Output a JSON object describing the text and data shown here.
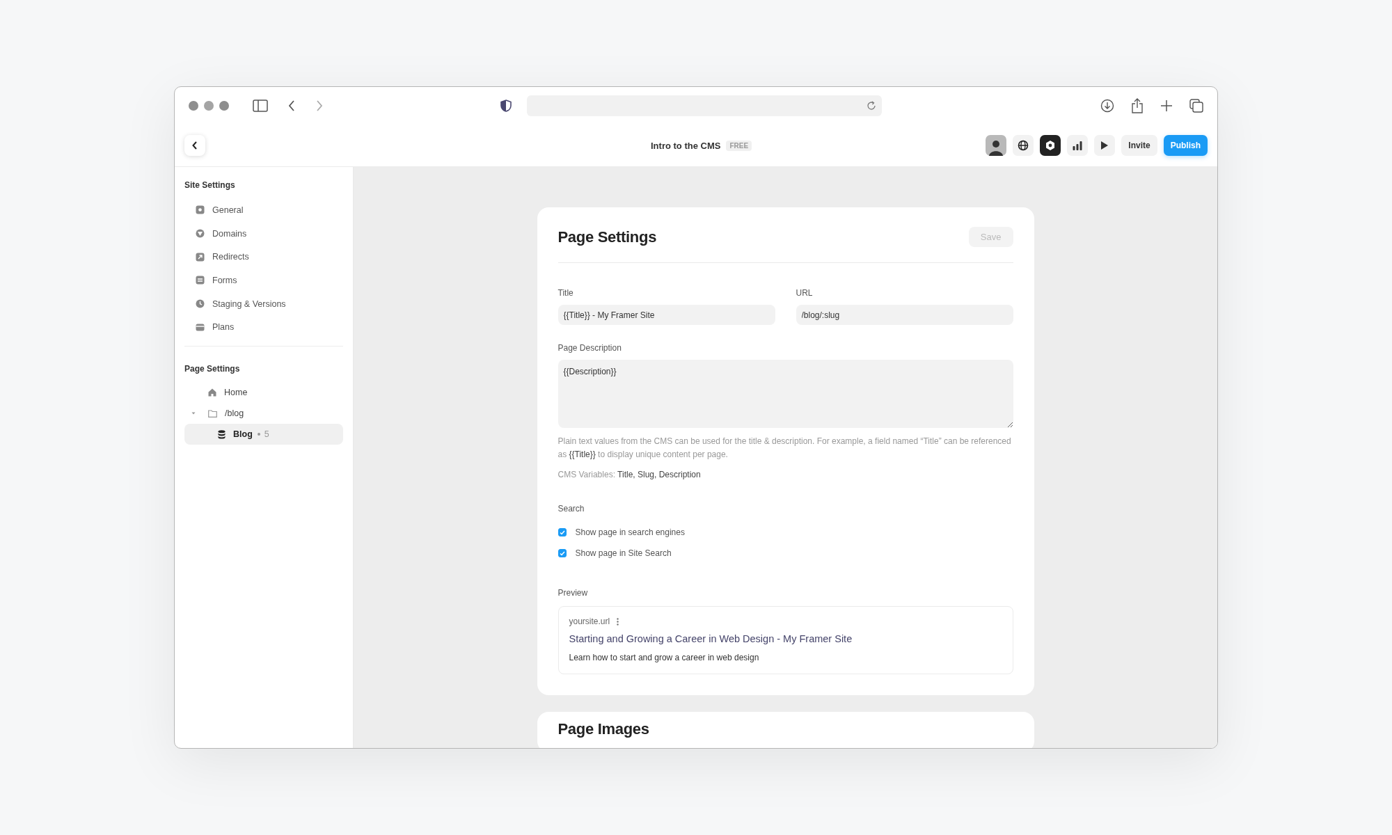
{
  "app_header": {
    "title": "Intro to the CMS",
    "badge": "FREE",
    "buttons": [
      {
        "label": "Invite",
        "kind": "secondary"
      },
      {
        "label": "Publish",
        "kind": "primary"
      }
    ]
  },
  "sidebar": {
    "site_settings": {
      "title": "Site Settings",
      "items": [
        {
          "label": "General",
          "kind": "general"
        },
        {
          "label": "Domains",
          "kind": "domains"
        },
        {
          "label": "Redirects",
          "kind": "redirects"
        },
        {
          "label": "Forms",
          "kind": "forms"
        },
        {
          "label": "Staging & Versions",
          "kind": "staging"
        },
        {
          "label": "Plans",
          "kind": "plans"
        }
      ]
    },
    "page_settings": {
      "title": "Page Settings",
      "tree": [
        {
          "label": "Home",
          "kind": "home",
          "selected": false
        },
        {
          "label": "/blog",
          "kind": "folder",
          "selected": false,
          "expanded": true,
          "children": [
            {
              "label": "Blog",
              "kind": "collection",
              "count": "5",
              "selected": true
            }
          ]
        }
      ]
    }
  },
  "card": {
    "title": "Page Settings",
    "save_button": {
      "label": "Save",
      "disabled": true
    },
    "fields": [
      {
        "label": "Title",
        "value": "{{Title}} - My Framer Site"
      },
      {
        "label": "URL",
        "value": "/blog/:slug"
      }
    ],
    "description": {
      "label": "Page Description",
      "value": "{{Description}}"
    },
    "help": "Plain text values from the CMS can be used for the title & description. For example, a field named “Title” can be referenced as **{{Title}}** to display unique content per page.",
    "cms_variables": "CMS Variables: **Title, Slug, Description**",
    "search": {
      "label": "Search",
      "options": [
        {
          "label": "Show page in search engines",
          "checked": true
        },
        {
          "label": "Show page in Site Search",
          "checked": true
        }
      ]
    },
    "preview": {
      "label": "Preview",
      "domain": "yoursite.url",
      "title": "Starting and Growing a Career in Web Design - My Framer Site",
      "description": "Learn how to start and grow a career in web design"
    }
  },
  "next_card": {
    "title": "Page Images"
  }
}
